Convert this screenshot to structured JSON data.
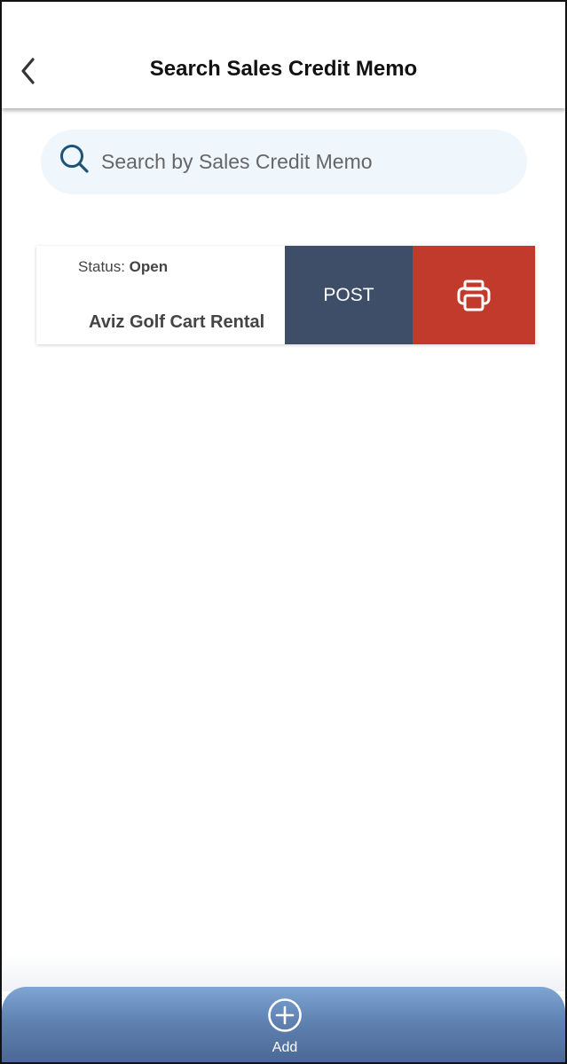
{
  "header": {
    "title": "Search Sales Credit Memo"
  },
  "search": {
    "placeholder": "Search by Sales Credit Memo"
  },
  "memos": [
    {
      "status_label": "Status:",
      "status_value": "Open",
      "customer": "Aviz Golf Cart Rental",
      "post_label": "POST"
    }
  ],
  "bottom_bar": {
    "add_label": "Add"
  },
  "colors": {
    "post_action": "#3e4e68",
    "print_action": "#c23a2b",
    "search_background": "#eff6fc",
    "search_icon": "#1e5377",
    "bottom_bar": "#6189bb"
  },
  "icons": {
    "back": "chevron-left-icon",
    "search": "search-icon",
    "print": "printer-icon",
    "add": "plus-circle-icon"
  }
}
